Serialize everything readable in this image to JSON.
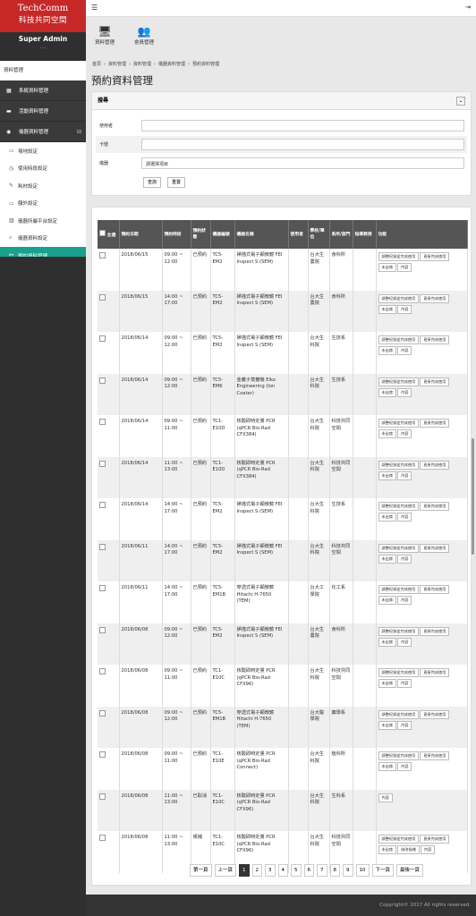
{
  "brand": {
    "line1": "TechComm",
    "line2": "科技共同空間"
  },
  "user": {
    "name": "Super Admin",
    "dots": "..."
  },
  "sidebar": {
    "heading": "資料管理",
    "main_items": [
      {
        "label": "系統資料管理",
        "icon": "grid-icon"
      },
      {
        "label": "活動資料管理",
        "icon": "folder-icon"
      },
      {
        "label": "儀器資料管理",
        "icon": "camera-icon"
      }
    ],
    "sub_items": [
      {
        "label": "場地設定",
        "icon": "doc-icon",
        "active": false
      },
      {
        "label": "使用時段設定",
        "icon": "clock-icon",
        "active": false
      },
      {
        "label": "耗材設定",
        "icon": "wrench-icon",
        "active": false
      },
      {
        "label": "額外設定",
        "icon": "doc-icon",
        "active": false
      },
      {
        "label": "儀器所屬平台設定",
        "icon": "building-icon",
        "active": false
      },
      {
        "label": "儀器資料設定",
        "icon": "search-icon",
        "active": false
      },
      {
        "label": "預約資料管理",
        "icon": "share-icon",
        "active": true
      },
      {
        "label": "繳費資料查詢",
        "icon": "yen-icon",
        "active": false
      }
    ]
  },
  "quick": {
    "btn1": "資料管理",
    "btn2": "會員管理"
  },
  "breadcrumb": [
    "首頁",
    "›",
    "資料管理",
    "›",
    "資料管理",
    "›",
    "儀器資料管理",
    "›",
    "預約資料管理"
  ],
  "page_title": "預約資料管理",
  "search": {
    "title": "搜尋",
    "toggle": "⌄",
    "user_label": "使用者",
    "card_label": "卡號",
    "instrument_label": "儀器",
    "instrument_value": "請選擇項目",
    "query_btn": "查詢",
    "reset_btn": "重置"
  },
  "table": {
    "headers": [
      "全選",
      "預約日期",
      "預約時段",
      "預約狀態",
      "儀器編號",
      "儀器名稱",
      "使用者",
      "學校/單位",
      "系所/部門",
      "指導教授",
      "功能"
    ],
    "rows": [
      {
        "date": "2018/06/15",
        "time": "09:00 ~ 12:00",
        "status": "已預約",
        "code": "TC5-EM2",
        "name": "掃描式電子顯微鏡 FEI Inspect S (SEM)",
        "user": "",
        "school": "台大生農院",
        "dept": "食科所",
        "prof": "",
        "actions": [
          "調整紀錄並完成使用",
          "直接完成使用",
          "未出席",
          "內容"
        ]
      },
      {
        "date": "2018/06/15",
        "time": "14:00 ~ 17:00",
        "status": "已預約",
        "code": "TC5-EM2",
        "name": "掃描式電子顯微鏡 FEI Inspect S (SEM)",
        "user": "",
        "school": "台大生農院",
        "dept": "食科所",
        "prof": "",
        "actions": [
          "調整紀錄並完成使用",
          "直接完成使用",
          "未出席",
          "內容"
        ]
      },
      {
        "date": "2018/06/14",
        "time": "09:00 ~ 12:00",
        "status": "已預約",
        "code": "TC5-EM2",
        "name": "掃描式電子顯微鏡 FEI Inspect S (SEM)",
        "user": "",
        "school": "台大生科院",
        "dept": "生技系",
        "prof": "",
        "actions": [
          "調整紀錄並完成使用",
          "直接完成使用",
          "未出席",
          "內容"
        ]
      },
      {
        "date": "2018/06/14",
        "time": "09:00 ~ 12:00",
        "status": "已預約",
        "code": "TC5-EM6",
        "name": "金離子蒸鍍機 Elko Engineering (Ion Coater)",
        "user": "",
        "school": "台大生科院",
        "dept": "生技系",
        "prof": "",
        "actions": [
          "調整紀錄並完成使用",
          "直接完成使用",
          "未出席",
          "內容"
        ]
      },
      {
        "date": "2018/06/14",
        "time": "09:00 ~ 11:00",
        "status": "已預約",
        "code": "TC1-E10D",
        "name": "核酸即時定量 PCR (qPCR Bio-Rad CFX384)",
        "user": "",
        "school": "台大生科院",
        "dept": "科技共同空間",
        "prof": "",
        "actions": [
          "調整紀錄並完成使用",
          "直接完成使用",
          "未出席",
          "內容"
        ]
      },
      {
        "date": "2018/06/14",
        "time": "11:00 ~ 13:00",
        "status": "已預約",
        "code": "TC1-E10D",
        "name": "核酸即時定量 PCR (qPCR Bio-Rad CFX384)",
        "user": "",
        "school": "台大生科院",
        "dept": "科技共同空間",
        "prof": "",
        "actions": [
          "調整紀錄並完成使用",
          "直接完成使用",
          "未出席",
          "內容"
        ]
      },
      {
        "date": "2018/06/14",
        "time": "14:00 ~ 17:00",
        "status": "已預約",
        "code": "TC5-EM2",
        "name": "掃描式電子顯微鏡 FEI Inspect S (SEM)",
        "user": "",
        "school": "台大生科院",
        "dept": "生技系",
        "prof": "",
        "actions": [
          "調整紀錄並完成使用",
          "直接完成使用",
          "未出席",
          "內容"
        ]
      },
      {
        "date": "2018/06/11",
        "time": "14:00 ~ 17:00",
        "status": "已預約",
        "code": "TC5-EM2",
        "name": "掃描式電子顯微鏡 FEI Inspect S (SEM)",
        "user": "",
        "school": "台大生科院",
        "dept": "科技共同空間",
        "prof": "",
        "actions": [
          "調整紀錄並完成使用",
          "直接完成使用",
          "未出席",
          "內容"
        ]
      },
      {
        "date": "2018/06/11",
        "time": "14:00 ~ 17:00",
        "status": "已預約",
        "code": "TC5-EM1B",
        "name": "穿透式電子顯微鏡 Hitachi H-7650 (TEM)",
        "user": "",
        "school": "台大工學院",
        "dept": "化工系",
        "prof": "",
        "actions": [
          "調整紀錄並完成使用",
          "直接完成使用",
          "未出席",
          "內容"
        ]
      },
      {
        "date": "2018/06/08",
        "time": "09:00 ~ 12:00",
        "status": "已預約",
        "code": "TC5-EM2",
        "name": "掃描式電子顯微鏡 FEI Inspect S (SEM)",
        "user": "",
        "school": "台大生農院",
        "dept": "食科所",
        "prof": "",
        "actions": [
          "調整紀錄並完成使用",
          "直接完成使用",
          "未出席",
          "內容"
        ]
      },
      {
        "date": "2018/06/08",
        "time": "09:00 ~ 11:00",
        "status": "已預約",
        "code": "TC1-E10C",
        "name": "核酸即時定量 PCR (qPCR Bio-Rad CFX96)",
        "user": "",
        "school": "台大生科院",
        "dept": "科技共同空間",
        "prof": "",
        "actions": [
          "調整紀錄並完成使用",
          "直接完成使用",
          "未出席",
          "內容"
        ]
      },
      {
        "date": "2018/06/08",
        "time": "09:00 ~ 12:00",
        "status": "已預約",
        "code": "TC5-EM1B",
        "name": "穿透式電子顯微鏡 Hitachi H-7650 (TEM)",
        "user": "",
        "school": "台大醫學院",
        "dept": "藥學系",
        "prof": "",
        "actions": [
          "調整紀錄並完成使用",
          "直接完成使用",
          "未出席",
          "內容"
        ]
      },
      {
        "date": "2018/06/08",
        "time": "09:00 ~ 11:00",
        "status": "已預約",
        "code": "TC1-E10E",
        "name": "核酸即時定量 PCR (qPCR Bio-Rad Connect)",
        "user": "",
        "school": "台大生科院",
        "dept": "植科所",
        "prof": "",
        "actions": [
          "調整紀錄並完成使用",
          "直接完成使用",
          "未出席",
          "內容"
        ]
      },
      {
        "date": "2018/06/08",
        "time": "11:00 ~ 13:00",
        "status": "已取消",
        "code": "TC1-E10C",
        "name": "核酸即時定量 PCR (qPCR Bio-Rad CFX96)",
        "user": "",
        "school": "台大生科院",
        "dept": "生科系",
        "prof": "",
        "actions": [
          "內容"
        ]
      },
      {
        "date": "2018/06/08",
        "time": "11:00 ~ 13:00",
        "status": "候補",
        "code": "TC1-E10C",
        "name": "核酸即時定量 PCR (qPCR Bio-Rad CFX96)",
        "user": "",
        "school": "台大生科院",
        "dept": "科技共同空間",
        "prof": "",
        "actions": [
          "調整紀錄並完成使用",
          "直接完成使用",
          "未出席",
          "修改候補",
          "內容"
        ]
      }
    ]
  },
  "pager": [
    "第一頁",
    "上一頁",
    "1",
    "2",
    "3",
    "4",
    "5",
    "6",
    "7",
    "8",
    "9",
    "10",
    "下一頁",
    "最後一頁"
  ],
  "pager_current": "1",
  "footer": "Copyright© 2017 All rights reserved."
}
